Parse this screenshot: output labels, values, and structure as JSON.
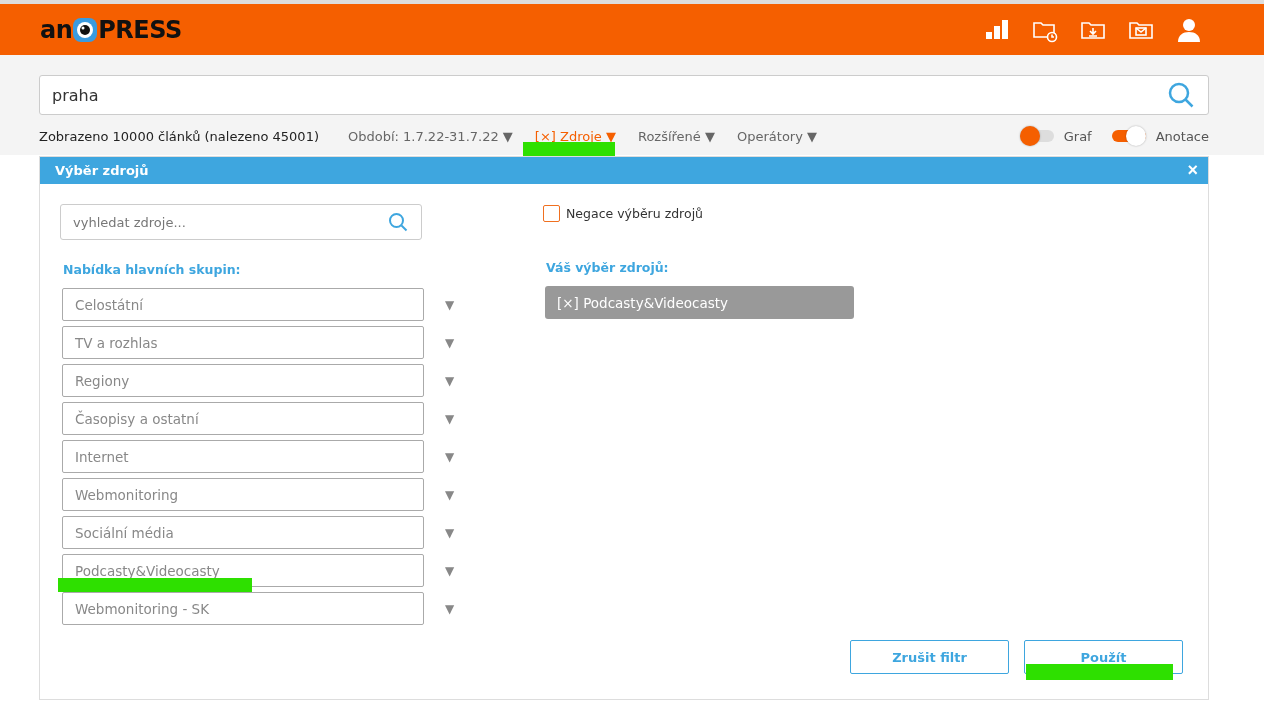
{
  "logo": {
    "left": "an",
    "right": "PRESS"
  },
  "search": {
    "value": "praha"
  },
  "stats": "Zobrazeno 10000 článků (nalezeno 45001)",
  "filters": [
    {
      "label": "Období: 1.7.22-31.7.22",
      "caret": "▼",
      "active": false
    },
    {
      "label": "[×] Zdroje",
      "caret": "▼",
      "active": true
    },
    {
      "label": "Rozšířené",
      "caret": "▼",
      "active": false
    },
    {
      "label": "Operátory",
      "caret": "▼",
      "active": false
    }
  ],
  "toggles": [
    {
      "label": "Graf",
      "on": false
    },
    {
      "label": "Anotace",
      "on": true
    }
  ],
  "dialog": {
    "title": "Výběr zdrojů",
    "close": "×",
    "source_search": {
      "placeholder": "vyhledat zdroje..."
    },
    "negation": {
      "label": "Negace výběru zdrojů",
      "checked": false
    },
    "groups_heading": "Nabídka hlavních skupin:",
    "groups": [
      {
        "label": "Celostátní",
        "caret": "▼"
      },
      {
        "label": "TV a rozhlas",
        "caret": "▼"
      },
      {
        "label": "Regiony",
        "caret": "▼"
      },
      {
        "label": "Časopisy a ostatní",
        "caret": "▼"
      },
      {
        "label": "Internet",
        "caret": "▼"
      },
      {
        "label": "Webmonitoring",
        "caret": "▼"
      },
      {
        "label": "Sociální média",
        "caret": "▼"
      },
      {
        "label": "Podcasty&Videocasty",
        "caret": "▼"
      },
      {
        "label": "Webmonitoring - SK",
        "caret": "▼"
      }
    ],
    "selection_heading": "Váš výběr zdrojů:",
    "selection": [
      "[×] Podcasty&Videocasty"
    ],
    "buttons": [
      "Zrušit filtr",
      "Použít"
    ]
  }
}
